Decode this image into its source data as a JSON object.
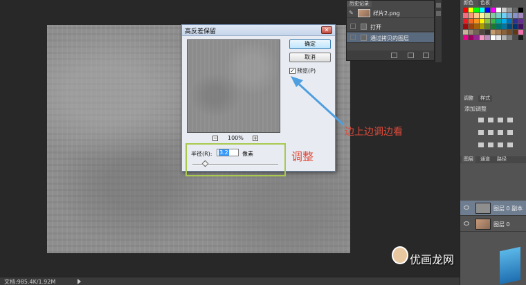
{
  "dialog": {
    "title": "高反差保留",
    "ok_label": "确定",
    "cancel_label": "取消",
    "preview_label": "预览(P)",
    "preview_checked": true,
    "zoom_level": "100%",
    "radius_label": "半径(R):",
    "radius_value": "3.2",
    "radius_unit": "像素"
  },
  "annotations": {
    "adjust": "调整",
    "check_while_adjusting": "边上边调边看"
  },
  "status_bar": {
    "doc_info": "文档:985.4K/1.92M"
  },
  "history_panel": {
    "tabs": [
      "历史记录"
    ],
    "snapshot_label": "样片2.png",
    "items": [
      "打开",
      "通过拷贝的图层"
    ]
  },
  "right_dock": {
    "top_tabs": [
      "颜色",
      "色板"
    ],
    "adjustments_tabs": [
      "调整",
      "样式"
    ],
    "adjustments_title": "添加调整",
    "layers_tabs": [
      "图层",
      "通道",
      "路径"
    ],
    "layers": [
      {
        "name": "图层 0 副本",
        "selected": true
      },
      {
        "name": "图层 0",
        "selected": false
      }
    ]
  },
  "watermark": {
    "text": "优画龙网"
  },
  "colors": {
    "annotation_red": "#e04a3a",
    "highlight_green": "#a9c94e",
    "arrow_blue": "#4f9fe0",
    "selection_blue": "#3399ff"
  }
}
